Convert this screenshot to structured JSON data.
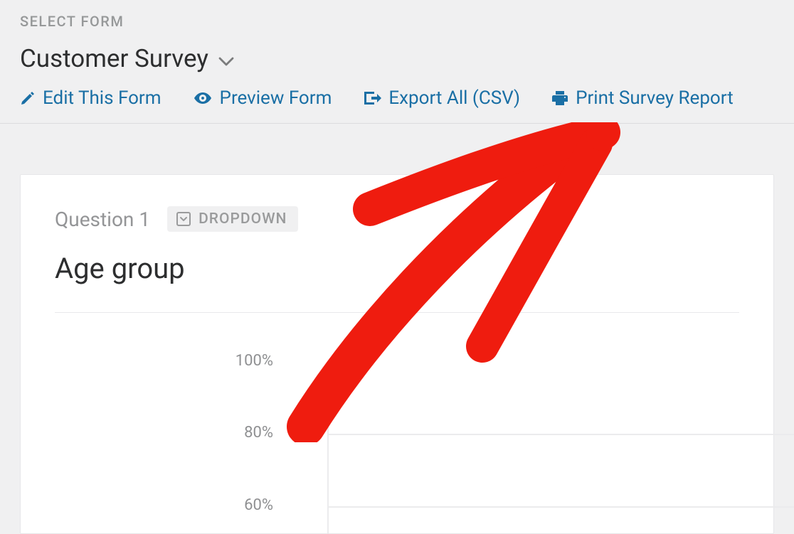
{
  "header": {
    "select_label": "SELECT FORM",
    "form_name": "Customer Survey"
  },
  "actions": {
    "edit_label": "Edit This Form",
    "preview_label": "Preview Form",
    "export_label": "Export All (CSV)",
    "print_label": "Print Survey Report"
  },
  "question": {
    "number_label": "Question 1",
    "type_label": "DROPDOWN",
    "title": "Age group"
  },
  "chart_data": {
    "type": "bar",
    "title": "Age group",
    "ylabel": "",
    "xlabel": "",
    "ylim": [
      0,
      100
    ],
    "yticks_visible": [
      "100%",
      "80%",
      "60%"
    ],
    "categories": [],
    "values": []
  },
  "colors": {
    "link": "#1a6fa5",
    "annotation_red": "#ef1c0f"
  }
}
